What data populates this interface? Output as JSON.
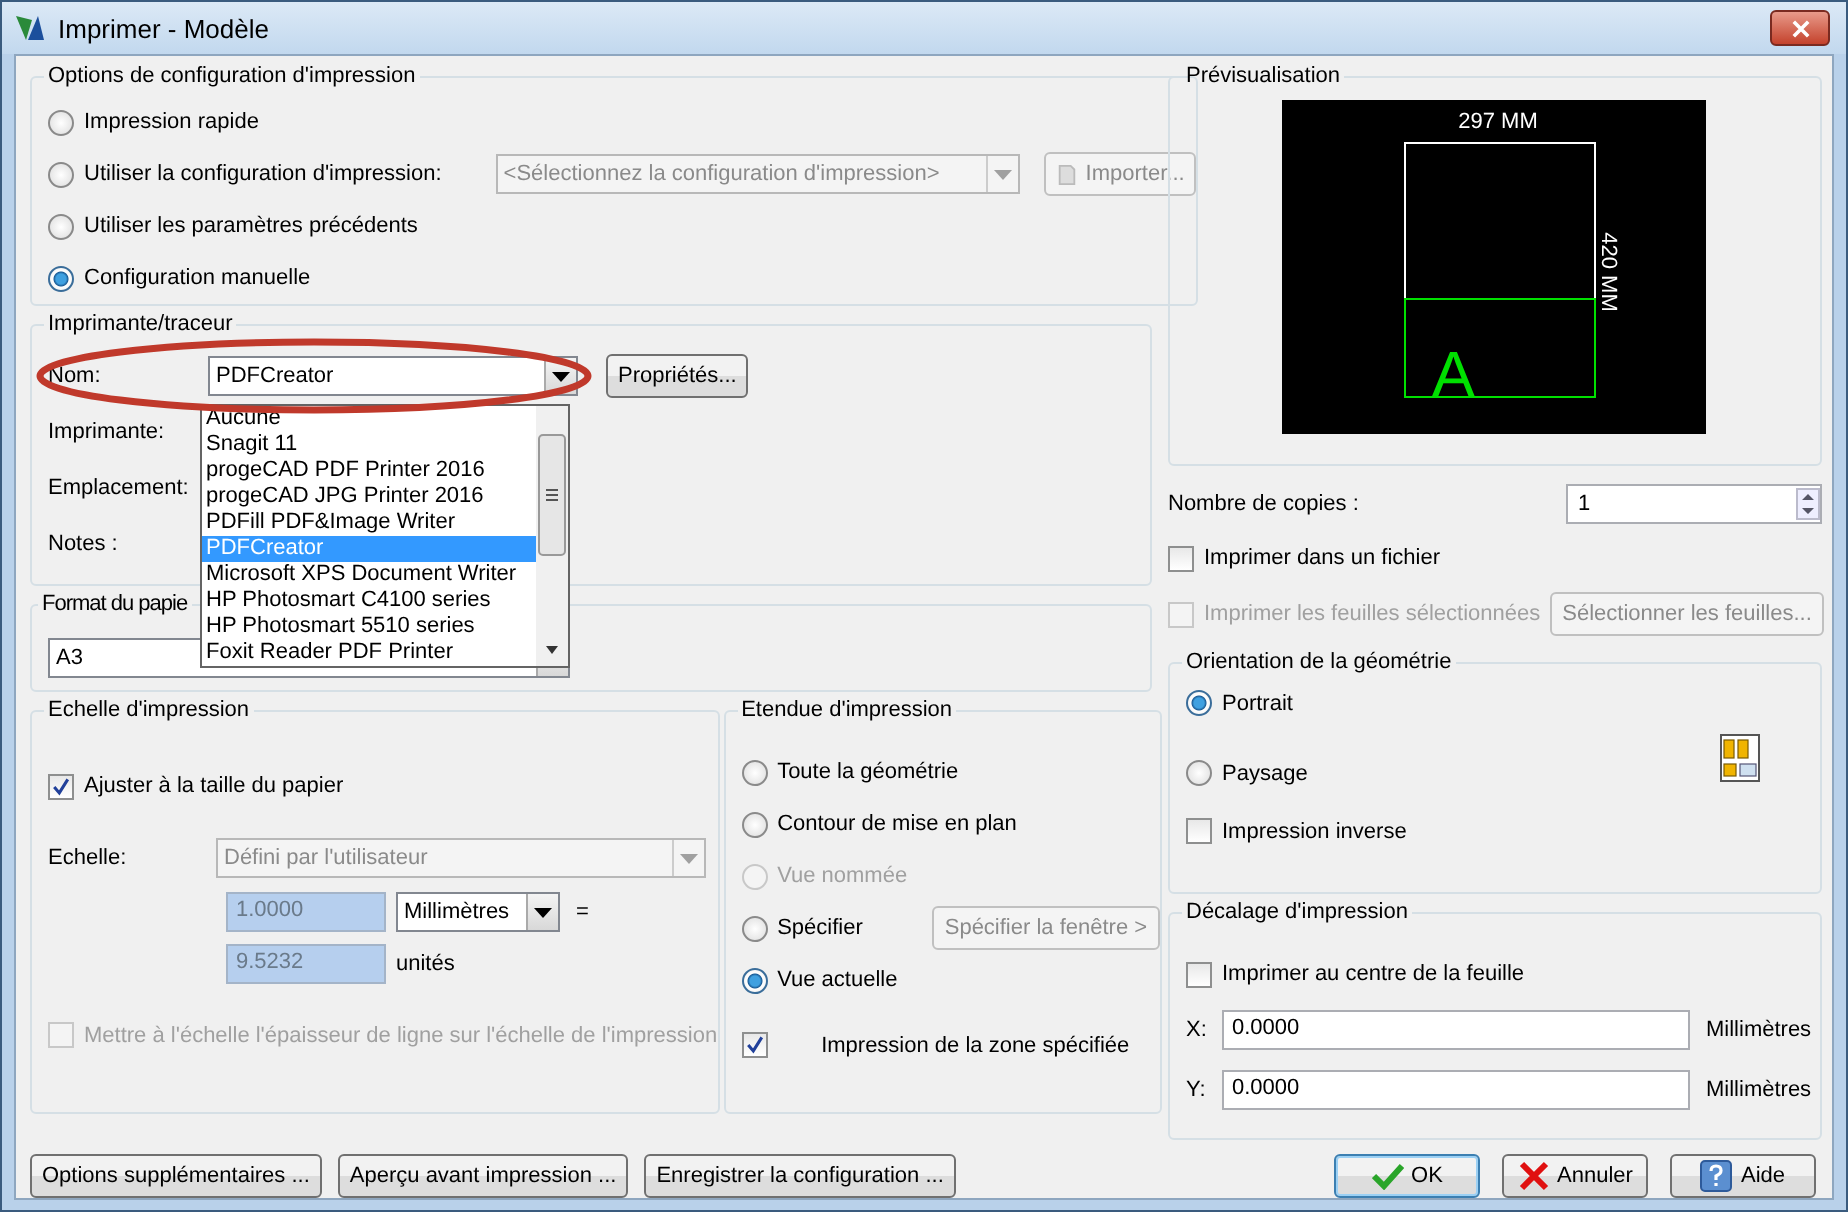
{
  "window": {
    "title": "Imprimer - Modèle"
  },
  "print_config": {
    "title": "Options de configuration d'impression",
    "options": [
      {
        "label": "Impression rapide",
        "selected": false
      },
      {
        "label": "Utiliser la configuration d'impression:",
        "selected": false,
        "combo": {
          "value": "<Sélectionnez la configuration d'impression>",
          "disabled": true
        },
        "button": {
          "label": "Importer...",
          "disabled": true
        }
      },
      {
        "label": "Utiliser les paramètres précédents",
        "selected": false
      },
      {
        "label": "Configuration manuelle",
        "selected": true
      }
    ]
  },
  "printer": {
    "title": "Imprimante/traceur",
    "name_label": "Nom:",
    "name_value": "PDFCreator",
    "properties_button": "Propriétés...",
    "labels": [
      "Imprimante:",
      "Emplacement:",
      "Notes :"
    ],
    "dropdown": {
      "items": [
        {
          "label": "Aucune",
          "selected": false
        },
        {
          "label": "Snagit 11",
          "selected": false
        },
        {
          "label": "progeCAD PDF Printer 2016",
          "selected": false
        },
        {
          "label": "progeCAD JPG Printer 2016",
          "selected": false
        },
        {
          "label": "PDFill PDF&Image Writer",
          "selected": false
        },
        {
          "label": "PDFCreator",
          "selected": true
        },
        {
          "label": "Microsoft XPS Document Writer",
          "selected": false
        },
        {
          "label": "HP Photosmart C4100 series",
          "selected": false
        },
        {
          "label": "HP Photosmart 5510 series",
          "selected": false
        },
        {
          "label": "Foxit Reader PDF Printer",
          "selected": false
        }
      ]
    }
  },
  "paper_format": {
    "title": "Format du papie",
    "value": "A3"
  },
  "scale": {
    "title": "Echelle d'impression",
    "fit": {
      "label": "Ajuster à la taille du papier",
      "checked": true,
      "disabled": false
    },
    "scale_label": "Echelle:",
    "scale_value": "Défini par l'utilisateur",
    "value1": "1.0000",
    "unit": "Millimètres",
    "equals": "=",
    "value2": "9.5232",
    "value2_unit": "unités",
    "lineweight": {
      "label": "Mettre à l'échelle l'épaisseur de ligne sur l'échelle de l'impression",
      "checked": false,
      "disabled": true
    }
  },
  "extent": {
    "title": "Etendue d'impression",
    "options": [
      {
        "label": "Toute la géométrie",
        "selected": false,
        "disabled": false
      },
      {
        "label": "Contour de mise en plan",
        "selected": false,
        "disabled": false
      },
      {
        "label": "Vue nommée",
        "selected": false,
        "disabled": true
      },
      {
        "label": "Spécifier",
        "selected": false,
        "disabled": false,
        "button": {
          "label": "Spécifier la fenêtre >",
          "disabled": true
        }
      },
      {
        "label": "Vue actuelle",
        "selected": true,
        "disabled": false
      }
    ],
    "zone": {
      "label": "Impression de la zone spécifiée",
      "checked": true,
      "disabled": false
    }
  },
  "preview": {
    "title": "Prévisualisation",
    "width_label": "297 MM",
    "height_label": "420 MM",
    "area_letter": "A"
  },
  "copies": {
    "label": "Nombre de copies :",
    "value": "1"
  },
  "print_to_file": {
    "label": "Imprimer dans un fichier",
    "checked": false,
    "disabled": false
  },
  "print_sheets": {
    "label": "Imprimer les feuilles sélectionnées",
    "checked": false,
    "disabled": true
  },
  "select_sheets_button": {
    "label": "Sélectionner les feuilles...",
    "disabled": true
  },
  "orientation": {
    "title": "Orientation de la géométrie",
    "options": [
      {
        "label": "Portrait",
        "selected": true
      },
      {
        "label": "Paysage",
        "selected": false
      }
    ],
    "reverse": {
      "label": "Impression inverse",
      "checked": false,
      "disabled": false
    }
  },
  "offset": {
    "title": "Décalage d'impression",
    "center": {
      "label": "Imprimer au centre de la feuille",
      "checked": false,
      "disabled": false
    },
    "fields": [
      {
        "label": "X:",
        "value": "0.0000",
        "unit": "Millimètres"
      },
      {
        "label": "Y:",
        "value": "0.0000",
        "unit": "Millimètres"
      }
    ]
  },
  "buttons": [
    {
      "label": "Options supplémentaires ...",
      "kind": "plain"
    },
    {
      "label": "Aperçu avant impression ...",
      "kind": "plain"
    },
    {
      "label": "Enregistrer la configuration ...",
      "kind": "plain"
    },
    {
      "label": "OK",
      "kind": "ok"
    },
    {
      "label": "Annuler",
      "kind": "cancel"
    },
    {
      "label": "Aide",
      "kind": "help"
    }
  ]
}
